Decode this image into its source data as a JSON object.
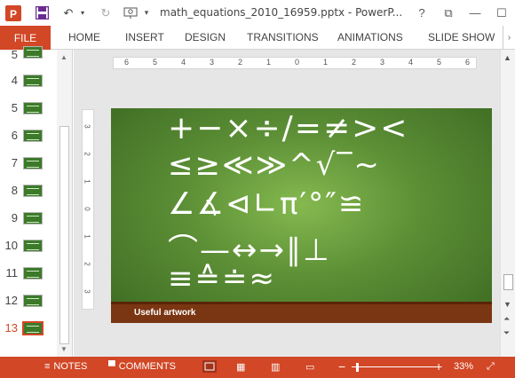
{
  "window": {
    "title": "math_equations_2010_16959.pptx - PowerP...",
    "controls": {
      "help": "?",
      "restore": "⧉",
      "minimize": "—",
      "maximize": "☐"
    }
  },
  "quick_access": {
    "app_icon": "powerpoint-icon",
    "save_icon": "save-icon",
    "undo_icon": "undo-icon",
    "redo_icon": "redo-icon",
    "start_icon": "start-from-beginning-icon",
    "customize_icon": "customize-qat-icon"
  },
  "ribbon": {
    "file_label": "FILE",
    "tabs": [
      "HOME",
      "INSERT",
      "DESIGN",
      "TRANSITIONS",
      "ANIMATIONS",
      "SLIDE SHOW"
    ],
    "more": "›"
  },
  "thumbnails": {
    "numbers": [
      "5",
      "4",
      "5",
      "6",
      "7",
      "8",
      "9",
      "10",
      "11",
      "12",
      "13"
    ],
    "active": "13"
  },
  "rulers": {
    "horizontal": [
      "6",
      "5",
      "4",
      "3",
      "2",
      "1",
      "0",
      "1",
      "2",
      "3",
      "4",
      "5",
      "6"
    ],
    "vertical": [
      "3",
      "2",
      "1",
      "0",
      "1",
      "2",
      "3"
    ]
  },
  "slide": {
    "symbol_lines": [
      "+−×÷/=≠><",
      "≤≥≪≫^√‾~",
      "∠∡⊲∟π′°″≌",
      "⌒—↔→∥⊥",
      "≡≙≐≈"
    ],
    "footer_text": "Useful artwork",
    "colors": {
      "board": "#5b8e35",
      "footer": "#7a3512"
    }
  },
  "statusbar": {
    "notes": "NOTES",
    "comments": "COMMENTS",
    "minus": "−",
    "plus": "+",
    "zoom": "33%",
    "accent": "#d24726"
  }
}
